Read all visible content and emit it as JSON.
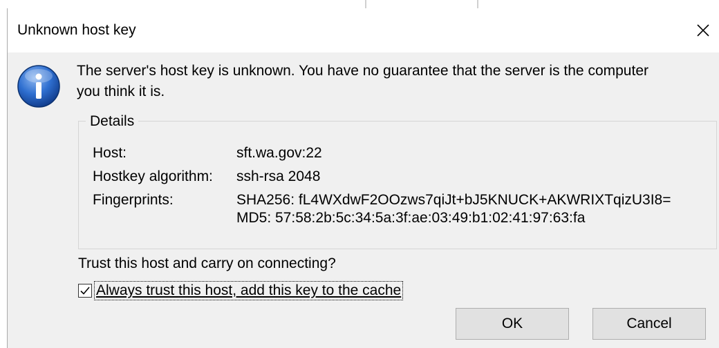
{
  "dialog": {
    "title": "Unknown host key",
    "close_icon": "close-icon",
    "message": "The server's host key is unknown. You have no guarantee that the server is the computer you think it is.",
    "info_icon": "info-icon"
  },
  "details": {
    "legend": "Details",
    "host_label": "Host:",
    "host_value": "sft.wa.gov:22",
    "algorithm_label": "Hostkey algorithm:",
    "algorithm_value": "ssh-rsa 2048",
    "fingerprints_label": "Fingerprints:",
    "fingerprint_sha256": "SHA256: fL4WXdwF2OOzws7qiJt+bJ5KNUCK+AKWRIXTqizU3I8=",
    "fingerprint_md5": "MD5: 57:58:2b:5c:34:5a:3f:ae:03:49:b1:02:41:97:63:fa"
  },
  "prompt": {
    "question": "Trust this host and carry on connecting?",
    "checkbox_label": "Always trust this host, add this key to the cache",
    "checkbox_checked": true
  },
  "buttons": {
    "ok_label": "OK",
    "cancel_label": "Cancel"
  },
  "colors": {
    "dialog_bg": "#f0f0f0",
    "titlebar_bg": "#ffffff",
    "button_bg": "#e1e1e1",
    "button_border": "#adadad",
    "info_icon_blue": "#1f5fbf"
  }
}
